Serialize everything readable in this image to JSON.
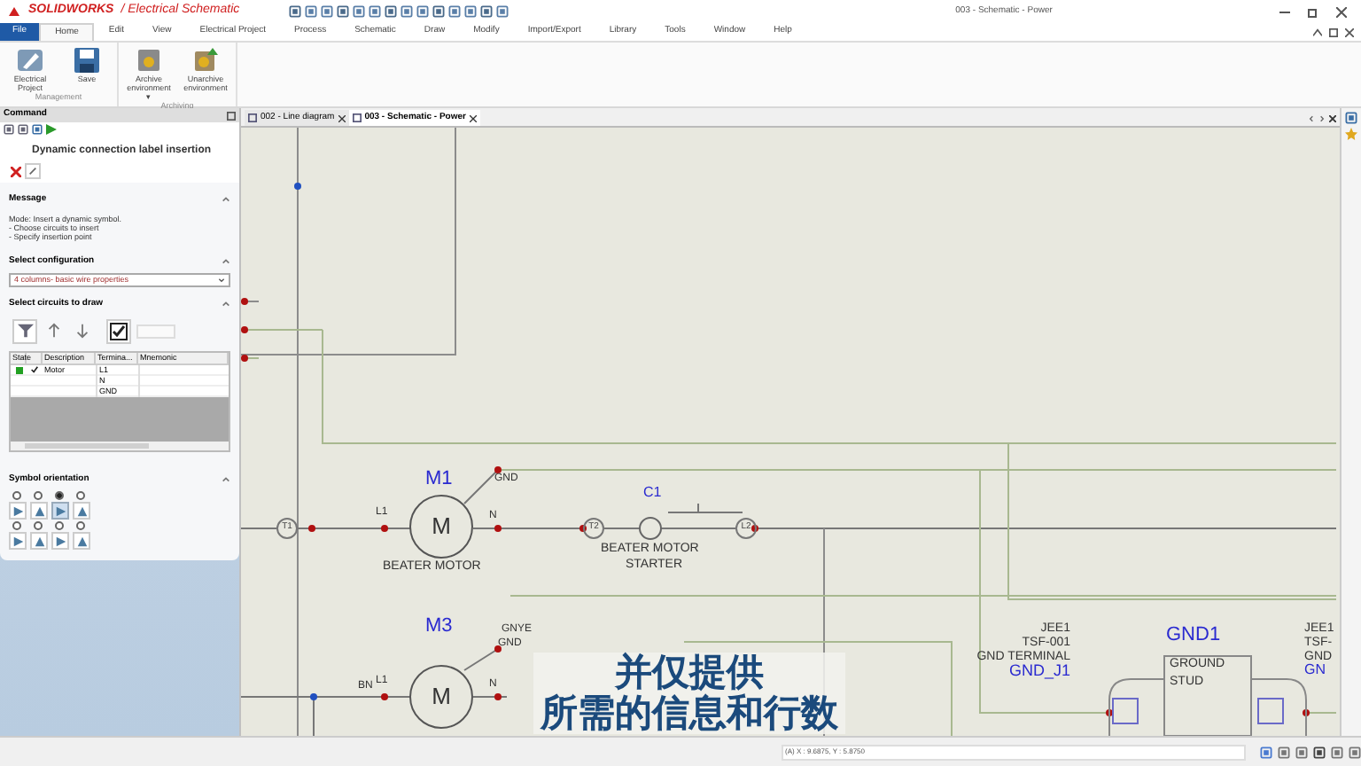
{
  "app": {
    "brand": "SOLIDWORKS",
    "product": "/ Electrical Schematic",
    "title": "003 - Schematic - Power"
  },
  "menu": [
    {
      "label": "File",
      "kind": "file",
      "selected": false
    },
    {
      "label": "Home",
      "kind": "tab",
      "selected": true
    },
    {
      "label": "Edit",
      "kind": "tab",
      "selected": false
    },
    {
      "label": "View",
      "kind": "tab",
      "selected": false
    },
    {
      "label": "Electrical Project",
      "kind": "tab",
      "selected": false
    },
    {
      "label": "Process",
      "kind": "tab",
      "selected": false
    },
    {
      "label": "Schematic",
      "kind": "tab",
      "selected": false
    },
    {
      "label": "Draw",
      "kind": "tab",
      "selected": false
    },
    {
      "label": "Modify",
      "kind": "tab",
      "selected": false
    },
    {
      "label": "Import/Export",
      "kind": "tab",
      "selected": false
    },
    {
      "label": "Library",
      "kind": "tab",
      "selected": false
    },
    {
      "label": "Tools",
      "kind": "tab",
      "selected": false
    },
    {
      "label": "Window",
      "kind": "tab",
      "selected": false
    },
    {
      "label": "Help",
      "kind": "tab",
      "selected": false
    }
  ],
  "ribbon": [
    {
      "name": "Management",
      "buttons": [
        {
          "label": "Electrical Project"
        },
        {
          "label": "Save"
        }
      ]
    },
    {
      "name": "Archiving",
      "buttons": [
        {
          "label": "Archive environment ▾"
        },
        {
          "label": "Unarchive environment"
        }
      ]
    }
  ],
  "command": {
    "header": "Command",
    "title": "Dynamic connection label insertion",
    "message": {
      "heading": "Message",
      "lines": [
        "Mode: Insert a dynamic symbol.",
        "- Choose circuits to insert",
        "- Specify insertion point"
      ]
    },
    "configuration": {
      "heading": "Select configuration",
      "value": "4 columns- basic wire properties"
    },
    "circuits": {
      "heading": "Select circuits to draw",
      "columns": [
        "State",
        "",
        "Description",
        "Termina...",
        "Mnemonic"
      ],
      "rows": [
        {
          "kind": "circuit",
          "checked": true,
          "description": "Motor",
          "terminal": "L1"
        },
        {
          "kind": "terminal",
          "terminal": "N"
        },
        {
          "kind": "terminal",
          "terminal": "GND"
        }
      ]
    },
    "orientation": {
      "heading": "Symbol orientation",
      "options": [
        {
          "selected": false
        },
        {
          "selected": false
        },
        {
          "selected": true
        },
        {
          "selected": false
        },
        {
          "selected": false
        },
        {
          "selected": false
        },
        {
          "selected": false
        },
        {
          "selected": false
        }
      ]
    }
  },
  "doc_tabs": [
    {
      "label": "002 - Line diagram",
      "selected": false
    },
    {
      "label": "003 - Schematic - Power",
      "selected": true
    }
  ],
  "schematic": {
    "labels": [
      {
        "text": "M1",
        "kind": "tag"
      },
      {
        "text": "GND",
        "kind": "small"
      },
      {
        "text": "L1",
        "kind": "small"
      },
      {
        "text": "N",
        "kind": "small"
      },
      {
        "text": "C1",
        "kind": "tag-small"
      },
      {
        "text": "BEATER MOTOR",
        "kind": "name"
      },
      {
        "text": "BEATER MOTOR",
        "kind": "name"
      },
      {
        "text": "STARTER",
        "kind": "name"
      },
      {
        "text": "GNYE",
        "kind": "small"
      },
      {
        "text": "GND",
        "kind": "small"
      },
      {
        "text": "M3",
        "kind": "tag"
      },
      {
        "text": "BN",
        "kind": "small"
      },
      {
        "text": "L1",
        "kind": "small"
      },
      {
        "text": "N",
        "kind": "small"
      },
      {
        "text": "JEE1",
        "kind": "name-right"
      },
      {
        "text": "TSF-001",
        "kind": "name-right"
      },
      {
        "text": "GND TERMINAL",
        "kind": "name-right"
      },
      {
        "text": "GND_J1",
        "kind": "tag-right"
      },
      {
        "text": "GND1",
        "kind": "tag"
      },
      {
        "text": "GROUND",
        "kind": "name"
      },
      {
        "text": "STUD",
        "kind": "name"
      },
      {
        "text": "JEE1",
        "kind": "name"
      },
      {
        "text": "TSF-",
        "kind": "name"
      },
      {
        "text": "GND",
        "kind": "name"
      },
      {
        "text": "GN",
        "kind": "tag-small"
      }
    ],
    "terminals": [
      "T1",
      "T2",
      "L2"
    ],
    "motors": [
      "M",
      "M"
    ]
  },
  "caption": {
    "lines": [
      "并仅提供",
      "所需的信息和行数"
    ]
  },
  "status": {
    "coords": "(A) X : 9.6875, Y : 5.8750"
  }
}
